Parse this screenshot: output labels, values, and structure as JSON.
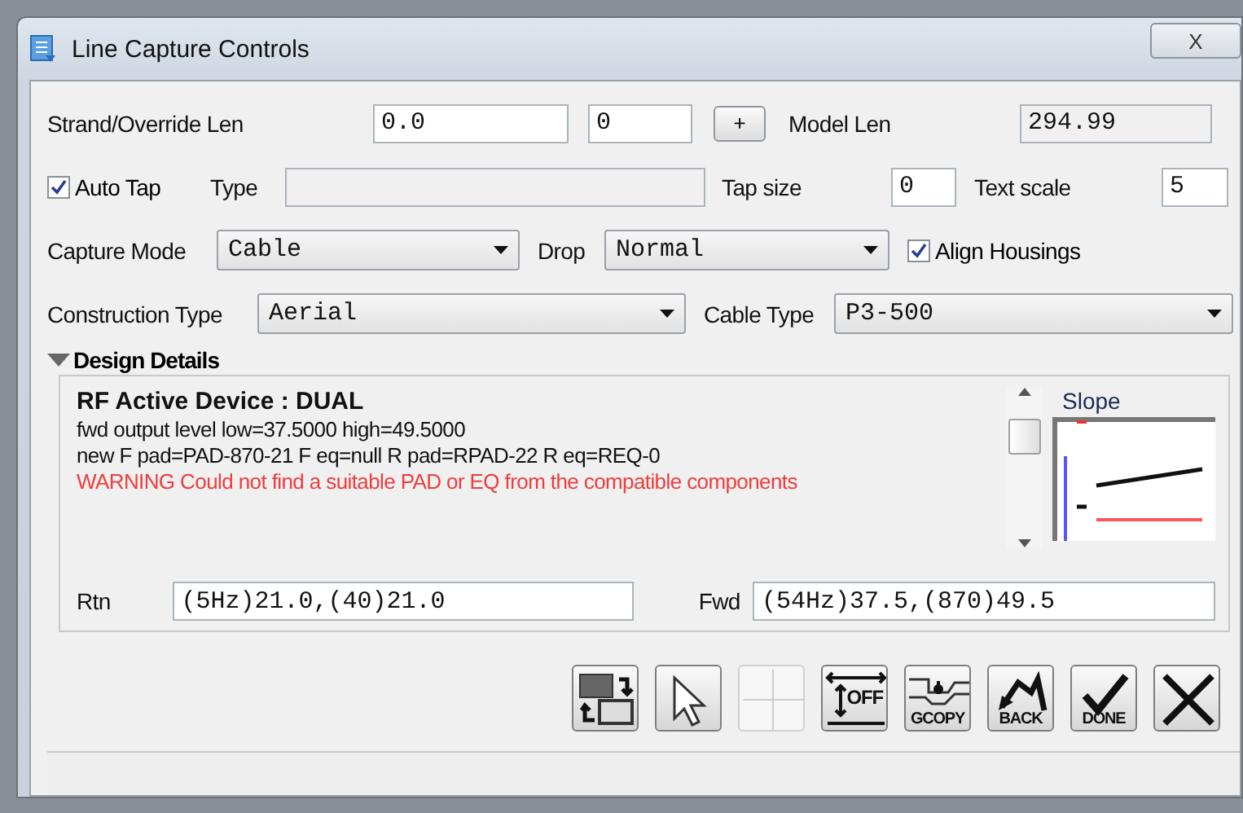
{
  "window": {
    "title": "Line Capture Controls",
    "close": "X"
  },
  "strand": {
    "label": "Strand/Override Len",
    "value1": "0.0",
    "value2": "0",
    "plus": "+",
    "model_label": "Model Len",
    "model_value": "294.99"
  },
  "tap": {
    "auto_tap": {
      "label": "Auto Tap",
      "checked": true
    },
    "type_label": "Type",
    "tap_size_label": "Tap size",
    "tap_size": "0",
    "text_scale_label": "Text scale",
    "text_scale": "5"
  },
  "capture": {
    "label": "Capture Mode",
    "value": "Cable",
    "drop_label": "Drop",
    "drop_value": "Normal",
    "align": {
      "label": "Align Housings",
      "checked": true
    }
  },
  "construction": {
    "label": "Construction Type",
    "value": "Aerial",
    "cable_label": "Cable Type",
    "cable_value": "P3-500"
  },
  "design_details": {
    "title": "Design Details",
    "expanded": true,
    "lines": [
      {
        "kind": "heading",
        "text": "RF Active Device : DUAL"
      },
      {
        "kind": "normal",
        "text": "fwd output level low=37.5000 high=49.5000"
      },
      {
        "kind": "normal",
        "text": "new F pad=PAD-870-21 F eq=null R pad=RPAD-22 R eq=REQ-0"
      },
      {
        "kind": "warning",
        "text": "WARNING Could not find a suitable PAD or EQ from the compatible components"
      }
    ],
    "slope_label": "Slope",
    "rtn_label": "Rtn",
    "rtn_value": "(5Hz)21.0,(40)21.0",
    "fwd_label": "Fwd",
    "fwd_value": "(54Hz)37.5,(870)49.5"
  },
  "toolbar": [
    {
      "kind": "swap",
      "disabled": false
    },
    {
      "kind": "pointer",
      "disabled": false
    },
    {
      "kind": "grid",
      "disabled": true
    },
    {
      "kind": "off",
      "label": "OFF",
      "disabled": false
    },
    {
      "kind": "gcopy",
      "label": "GCOPY",
      "disabled": false
    },
    {
      "kind": "back",
      "label": "BACK",
      "disabled": false
    },
    {
      "kind": "done",
      "label": "DONE",
      "disabled": false
    },
    {
      "kind": "cancel",
      "disabled": false
    }
  ]
}
